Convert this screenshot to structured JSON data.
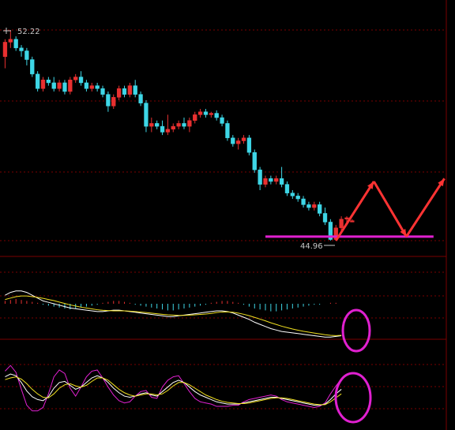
{
  "chart_data": [
    {
      "type": "candlestick",
      "title": "",
      "annotations": {
        "high_label": "52.22",
        "low_label": "44.96"
      },
      "colors": {
        "up": "#e83030",
        "down": "#3ed6e6",
        "support_line": "#e020d0",
        "arrows": "#ff3333",
        "grid": "#7a0000"
      },
      "support_level": 45.1,
      "projection_arrows": [
        {
          "from_index": 61,
          "from": 44.96,
          "to_index": 68,
          "to": 47.0
        },
        {
          "from_index": 68,
          "from": 47.0,
          "to_index": 74,
          "to": 45.1
        },
        {
          "from_index": 74,
          "from": 45.1,
          "to_index": 81,
          "to": 47.1
        }
      ],
      "candles": [
        {
          "o": 51.3,
          "h": 51.9,
          "l": 50.9,
          "c": 51.8
        },
        {
          "o": 51.8,
          "h": 52.22,
          "l": 51.6,
          "c": 51.9
        },
        {
          "o": 51.9,
          "h": 52.0,
          "l": 51.5,
          "c": 51.6
        },
        {
          "o": 51.6,
          "h": 51.7,
          "l": 51.3,
          "c": 51.5
        },
        {
          "o": 51.5,
          "h": 51.6,
          "l": 51.0,
          "c": 51.2
        },
        {
          "o": 51.2,
          "h": 51.3,
          "l": 50.6,
          "c": 50.7
        },
        {
          "o": 50.7,
          "h": 50.8,
          "l": 50.1,
          "c": 50.2
        },
        {
          "o": 50.2,
          "h": 50.6,
          "l": 50.1,
          "c": 50.5
        },
        {
          "o": 50.5,
          "h": 50.6,
          "l": 50.3,
          "c": 50.4
        },
        {
          "o": 50.4,
          "h": 50.6,
          "l": 50.1,
          "c": 50.2
        },
        {
          "o": 50.2,
          "h": 50.5,
          "l": 50.1,
          "c": 50.4
        },
        {
          "o": 50.4,
          "h": 50.5,
          "l": 50.0,
          "c": 50.1
        },
        {
          "o": 50.1,
          "h": 50.6,
          "l": 50.0,
          "c": 50.5
        },
        {
          "o": 50.5,
          "h": 50.7,
          "l": 50.4,
          "c": 50.6
        },
        {
          "o": 50.6,
          "h": 50.8,
          "l": 50.3,
          "c": 50.4
        },
        {
          "o": 50.4,
          "h": 50.5,
          "l": 50.1,
          "c": 50.2
        },
        {
          "o": 50.2,
          "h": 50.4,
          "l": 50.1,
          "c": 50.3
        },
        {
          "o": 50.3,
          "h": 50.4,
          "l": 50.1,
          "c": 50.2
        },
        {
          "o": 50.2,
          "h": 50.3,
          "l": 49.9,
          "c": 50.0
        },
        {
          "o": 50.0,
          "h": 50.1,
          "l": 49.4,
          "c": 49.6
        },
        {
          "o": 49.6,
          "h": 50.0,
          "l": 49.5,
          "c": 49.9
        },
        {
          "o": 49.9,
          "h": 50.3,
          "l": 49.8,
          "c": 50.2
        },
        {
          "o": 50.2,
          "h": 50.3,
          "l": 49.9,
          "c": 50.0
        },
        {
          "o": 50.0,
          "h": 50.4,
          "l": 49.9,
          "c": 50.3
        },
        {
          "o": 50.3,
          "h": 50.5,
          "l": 49.9,
          "c": 50.0
        },
        {
          "o": 50.0,
          "h": 50.1,
          "l": 49.6,
          "c": 49.7
        },
        {
          "o": 49.7,
          "h": 49.8,
          "l": 48.7,
          "c": 48.9
        },
        {
          "o": 48.9,
          "h": 49.2,
          "l": 48.7,
          "c": 49.0
        },
        {
          "o": 49.0,
          "h": 49.1,
          "l": 48.8,
          "c": 48.9
        },
        {
          "o": 48.9,
          "h": 49.1,
          "l": 48.6,
          "c": 48.7
        },
        {
          "o": 48.7,
          "h": 49.3,
          "l": 48.6,
          "c": 48.8
        },
        {
          "o": 48.8,
          "h": 49.0,
          "l": 48.7,
          "c": 48.9
        },
        {
          "o": 48.9,
          "h": 49.1,
          "l": 48.8,
          "c": 49.0
        },
        {
          "o": 49.0,
          "h": 49.2,
          "l": 48.8,
          "c": 48.9
        },
        {
          "o": 48.9,
          "h": 49.2,
          "l": 48.7,
          "c": 49.1
        },
        {
          "o": 49.1,
          "h": 49.4,
          "l": 49.0,
          "c": 49.3
        },
        {
          "o": 49.3,
          "h": 49.5,
          "l": 49.2,
          "c": 49.4
        },
        {
          "o": 49.4,
          "h": 49.5,
          "l": 49.2,
          "c": 49.3
        },
        {
          "o": 49.3,
          "h": 49.4,
          "l": 49.2,
          "c": 49.35
        },
        {
          "o": 49.35,
          "h": 49.45,
          "l": 49.1,
          "c": 49.2
        },
        {
          "o": 49.2,
          "h": 49.3,
          "l": 48.9,
          "c": 49.0
        },
        {
          "o": 49.0,
          "h": 49.1,
          "l": 48.4,
          "c": 48.5
        },
        {
          "o": 48.5,
          "h": 48.6,
          "l": 48.2,
          "c": 48.3
        },
        {
          "o": 48.3,
          "h": 48.5,
          "l": 48.1,
          "c": 48.4
        },
        {
          "o": 48.4,
          "h": 48.6,
          "l": 48.3,
          "c": 48.5
        },
        {
          "o": 48.5,
          "h": 48.6,
          "l": 47.9,
          "c": 48.0
        },
        {
          "o": 48.0,
          "h": 48.1,
          "l": 47.3,
          "c": 47.4
        },
        {
          "o": 47.4,
          "h": 47.5,
          "l": 46.7,
          "c": 46.9
        },
        {
          "o": 46.9,
          "h": 47.2,
          "l": 46.8,
          "c": 47.1
        },
        {
          "o": 47.1,
          "h": 47.2,
          "l": 46.9,
          "c": 47.0
        },
        {
          "o": 47.0,
          "h": 47.2,
          "l": 46.9,
          "c": 47.1
        },
        {
          "o": 47.1,
          "h": 47.5,
          "l": 46.8,
          "c": 46.9
        },
        {
          "o": 46.9,
          "h": 47.0,
          "l": 46.5,
          "c": 46.6
        },
        {
          "o": 46.6,
          "h": 46.7,
          "l": 46.4,
          "c": 46.5
        },
        {
          "o": 46.5,
          "h": 46.6,
          "l": 46.3,
          "c": 46.4
        },
        {
          "o": 46.4,
          "h": 46.5,
          "l": 46.1,
          "c": 46.2
        },
        {
          "o": 46.2,
          "h": 46.3,
          "l": 46.0,
          "c": 46.1
        },
        {
          "o": 46.1,
          "h": 46.3,
          "l": 46.0,
          "c": 46.2
        },
        {
          "o": 46.2,
          "h": 46.3,
          "l": 45.8,
          "c": 45.9
        },
        {
          "o": 45.9,
          "h": 46.1,
          "l": 45.5,
          "c": 45.6
        },
        {
          "o": 45.6,
          "h": 45.7,
          "l": 44.96,
          "c": 45.0
        },
        {
          "o": 45.0,
          "h": 45.5,
          "l": 44.96,
          "c": 45.4
        },
        {
          "o": 45.4,
          "h": 45.8,
          "l": 45.3,
          "c": 45.7
        },
        {
          "o": 45.7,
          "h": 45.8,
          "l": 45.6,
          "c": 45.75
        },
        {
          "o": 45.6,
          "h": 45.7,
          "l": 45.6,
          "c": 45.65
        }
      ]
    },
    {
      "type": "macd",
      "annotations": {
        "highlight": "circle"
      },
      "colors": {
        "dif": "#ffffff",
        "dea": "#f0e020",
        "hist_pos": "#e83030",
        "hist_neg": "#3ed6e6",
        "circle": "#e020d0"
      },
      "histogram": [
        3,
        4,
        5,
        4,
        3,
        2,
        1,
        -1,
        -2,
        -3,
        -4,
        -5,
        -6,
        -5,
        -4,
        -3,
        -2,
        -1,
        1,
        2,
        3,
        3,
        2,
        1,
        -1,
        -2,
        -3,
        -4,
        -5,
        -6,
        -7,
        -7,
        -6,
        -5,
        -4,
        -3,
        -2,
        -1,
        1,
        2,
        3,
        3,
        2,
        1,
        -1,
        -3,
        -5,
        -6,
        -7,
        -8,
        -8,
        -7,
        -6,
        -5,
        -4,
        -3,
        -2,
        -1,
        -1,
        0,
        1,
        1,
        0
      ],
      "dif": [
        0.6,
        0.8,
        0.9,
        0.9,
        0.8,
        0.6,
        0.4,
        0.2,
        0.1,
        0.0,
        -0.1,
        -0.2,
        -0.3,
        -0.35,
        -0.4,
        -0.45,
        -0.5,
        -0.55,
        -0.55,
        -0.5,
        -0.45,
        -0.45,
        -0.5,
        -0.55,
        -0.6,
        -0.65,
        -0.7,
        -0.75,
        -0.8,
        -0.85,
        -0.9,
        -0.9,
        -0.85,
        -0.8,
        -0.75,
        -0.7,
        -0.65,
        -0.6,
        -0.55,
        -0.5,
        -0.5,
        -0.55,
        -0.65,
        -0.8,
        -0.95,
        -1.1,
        -1.3,
        -1.45,
        -1.6,
        -1.75,
        -1.85,
        -1.95,
        -2.0,
        -2.05,
        -2.1,
        -2.15,
        -2.2,
        -2.25,
        -2.3,
        -2.35,
        -2.35,
        -2.3,
        -2.25
      ],
      "dea": [
        0.3,
        0.4,
        0.5,
        0.55,
        0.55,
        0.5,
        0.45,
        0.38,
        0.3,
        0.22,
        0.12,
        0.02,
        -0.08,
        -0.16,
        -0.24,
        -0.3,
        -0.36,
        -0.42,
        -0.46,
        -0.48,
        -0.5,
        -0.5,
        -0.5,
        -0.52,
        -0.55,
        -0.58,
        -0.62,
        -0.66,
        -0.7,
        -0.74,
        -0.78,
        -0.8,
        -0.82,
        -0.82,
        -0.8,
        -0.78,
        -0.75,
        -0.72,
        -0.68,
        -0.62,
        -0.58,
        -0.57,
        -0.6,
        -0.66,
        -0.74,
        -0.84,
        -0.96,
        -1.08,
        -1.2,
        -1.34,
        -1.46,
        -1.58,
        -1.68,
        -1.78,
        -1.86,
        -1.94,
        -2.0,
        -2.06,
        -2.12,
        -2.18,
        -2.22,
        -2.24,
        -2.22
      ]
    },
    {
      "type": "kdj",
      "annotations": {
        "highlight": "circle"
      },
      "colors": {
        "k": "#ffffff",
        "d": "#f0e020",
        "j": "#e020d0",
        "circle": "#e020d0"
      },
      "k": [
        70,
        75,
        72,
        60,
        45,
        35,
        30,
        28,
        35,
        50,
        60,
        62,
        55,
        48,
        52,
        60,
        68,
        72,
        68,
        60,
        50,
        42,
        36,
        34,
        36,
        40,
        42,
        38,
        36,
        44,
        52,
        60,
        64,
        60,
        52,
        44,
        38,
        34,
        30,
        26,
        24,
        22,
        22,
        22,
        24,
        26,
        28,
        30,
        32,
        34,
        34,
        32,
        30,
        28,
        26,
        24,
        22,
        20,
        20,
        22,
        30,
        40,
        48
      ],
      "d": [
        65,
        68,
        70,
        66,
        58,
        48,
        40,
        34,
        33,
        40,
        50,
        56,
        58,
        54,
        52,
        55,
        62,
        68,
        68,
        64,
        56,
        48,
        42,
        38,
        36,
        38,
        40,
        40,
        38,
        40,
        46,
        54,
        60,
        60,
        56,
        50,
        44,
        38,
        34,
        30,
        27,
        25,
        24,
        23,
        23,
        24,
        26,
        28,
        30,
        32,
        33,
        33,
        32,
        30,
        28,
        26,
        24,
        22,
        21,
        21,
        26,
        33,
        40
      ],
      "j": [
        80,
        90,
        78,
        48,
        20,
        10,
        10,
        16,
        40,
        70,
        82,
        76,
        50,
        36,
        52,
        70,
        80,
        82,
        68,
        52,
        38,
        28,
        24,
        26,
        36,
        44,
        46,
        34,
        32,
        52,
        64,
        70,
        72,
        58,
        44,
        32,
        26,
        24,
        22,
        18,
        18,
        18,
        20,
        20,
        26,
        30,
        32,
        34,
        36,
        38,
        36,
        30,
        26,
        24,
        22,
        20,
        18,
        16,
        18,
        24,
        40,
        54,
        66
      ]
    }
  ]
}
